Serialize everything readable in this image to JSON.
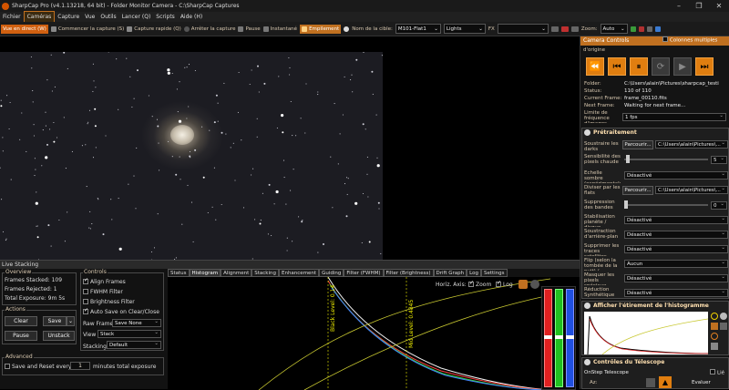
{
  "window": {
    "title": "SharpCap Pro (v4.1.13218, 64 bit) - Folder Monitor Camera - C:\\SharpCap Captures"
  },
  "menu": [
    "Fichier",
    "Caméras",
    "Capture",
    "Vue",
    "Outils",
    "Lancer (Q)",
    "Scripts",
    "Aide (H)"
  ],
  "toolbar": {
    "live": "Vue en direct (W)",
    "start_capture": "Commencer la capture (S)",
    "quick_capture": "Capture rapide (Q)",
    "stop_capture": "Arrêter la capture",
    "pause": "Pause",
    "snapshot": "Instantané",
    "stack": "Empilement",
    "target_label": "Nom de la cible:",
    "target_value": "M101-Flat1",
    "frame_type": "Lights",
    "fx": "FX",
    "zoom_label": "Zoom:",
    "zoom_value": "Auto"
  },
  "stacking": {
    "title": "Live Stacking",
    "overview_title": "Overview",
    "frames_stacked_label": "Frames Stacked:",
    "frames_stacked": "109",
    "frames_rejected_label": "Frames Rejected:",
    "frames_rejected": "1",
    "total_exposure_label": "Total Exposure:",
    "total_exposure": "9m 5s",
    "actions_title": "Actions",
    "clear": "Clear",
    "save": "Save",
    "pause": "Pause",
    "unstack": "Unstack",
    "advanced_title": "Advanced",
    "save_reset": "Save and Reset every",
    "save_reset_value": "1",
    "save_reset_suffix": "minutes total exposure",
    "controls_title": "Controls",
    "align_frames": "Align Frames",
    "fwhm_filter": "FWHM Filter",
    "brightness_filter": "Brightness Filter",
    "auto_save": "Auto Save on Clear/Close",
    "raw_frames_label": "Raw Frames",
    "raw_frames_value": "Save None",
    "view_label": "View",
    "view_value": "Stack",
    "stacking_label": "Stacking",
    "stacking_value": "Default",
    "tabs": [
      "Status",
      "Histogram",
      "Alignment",
      "Stacking",
      "Enhancement",
      "Guiding",
      "Filter (FWHM)",
      "Filter (Brightness)",
      "Drift Graph",
      "Log",
      "Settings"
    ],
    "horiz_axis": "Horiz. Axis:",
    "zoom": "Zoom",
    "log": "Log",
    "black_level": "Black Level: 0.14",
    "mid_level": "Mid Level: 0.4845"
  },
  "right": {
    "camera_title": "Camera Controls",
    "columns": "Colonnes multiples",
    "origin": "d'origine",
    "folder_label": "Folder:",
    "folder_value": "C:\\Users\\alain\\Pictures\\sharpcap_testi",
    "status_label": "Status:",
    "status_value": "110 of 110",
    "current_frame_label": "Current Frame:",
    "current_frame_value": "frame_00110.fits",
    "next_frame_label": "Next Frame:",
    "next_frame_value": "Waiting for next frame...",
    "freq_label": "Limite de fréquence d'images",
    "freq_value": "1 fps",
    "preproc_title": "Prétraitement",
    "darks_label": "Soustraire les darks",
    "darks_browse": "Parcourir...",
    "darks_path": "C:\\Users\\alain\\Pictures\\...",
    "hotpix_label": "Sensibilité des pixels chaude",
    "hotpix_value": "5",
    "scale_label": "Échelle sombre (expérimentale)",
    "scale_value": "Désactivé",
    "flats_label": "Diviser par les flats",
    "flats_browse": "Parcourir...",
    "flats_path": "C:\\Users\\alain\\Pictures\\...",
    "banding_label": "Suppression des bandes",
    "banding_value": "0",
    "stab_label": "Stabilisation planète / disque",
    "stab_value": "Désactivé",
    "bg_label": "Soustraction d'arrière-plan",
    "bg_value": "Désactivé",
    "sat_label": "Supprimer les traces satellites",
    "sat_value": "Désactivé",
    "tilt_label": "Flip (selon la tombée de la nuit) / ...",
    "tilt_value": "Aucun",
    "mask_label": "Masquer les pixels spéciaux",
    "mask_value": "Désactivé",
    "denoise_label": "Réduction Synthétique Bleu",
    "denoise_value": "Désactivé",
    "histo_title": "Afficher l'étirement de l'histogramme",
    "telescope_title": "Contrôles du Télescope",
    "telescope_name": "OnStep Telescope",
    "telescope_connected": "Lié",
    "az_label": "Az:",
    "evaluate": "Evaluer"
  },
  "colors": {
    "accent": "#e07e10",
    "panel": "#1e1e1e",
    "bg": "#000000"
  }
}
